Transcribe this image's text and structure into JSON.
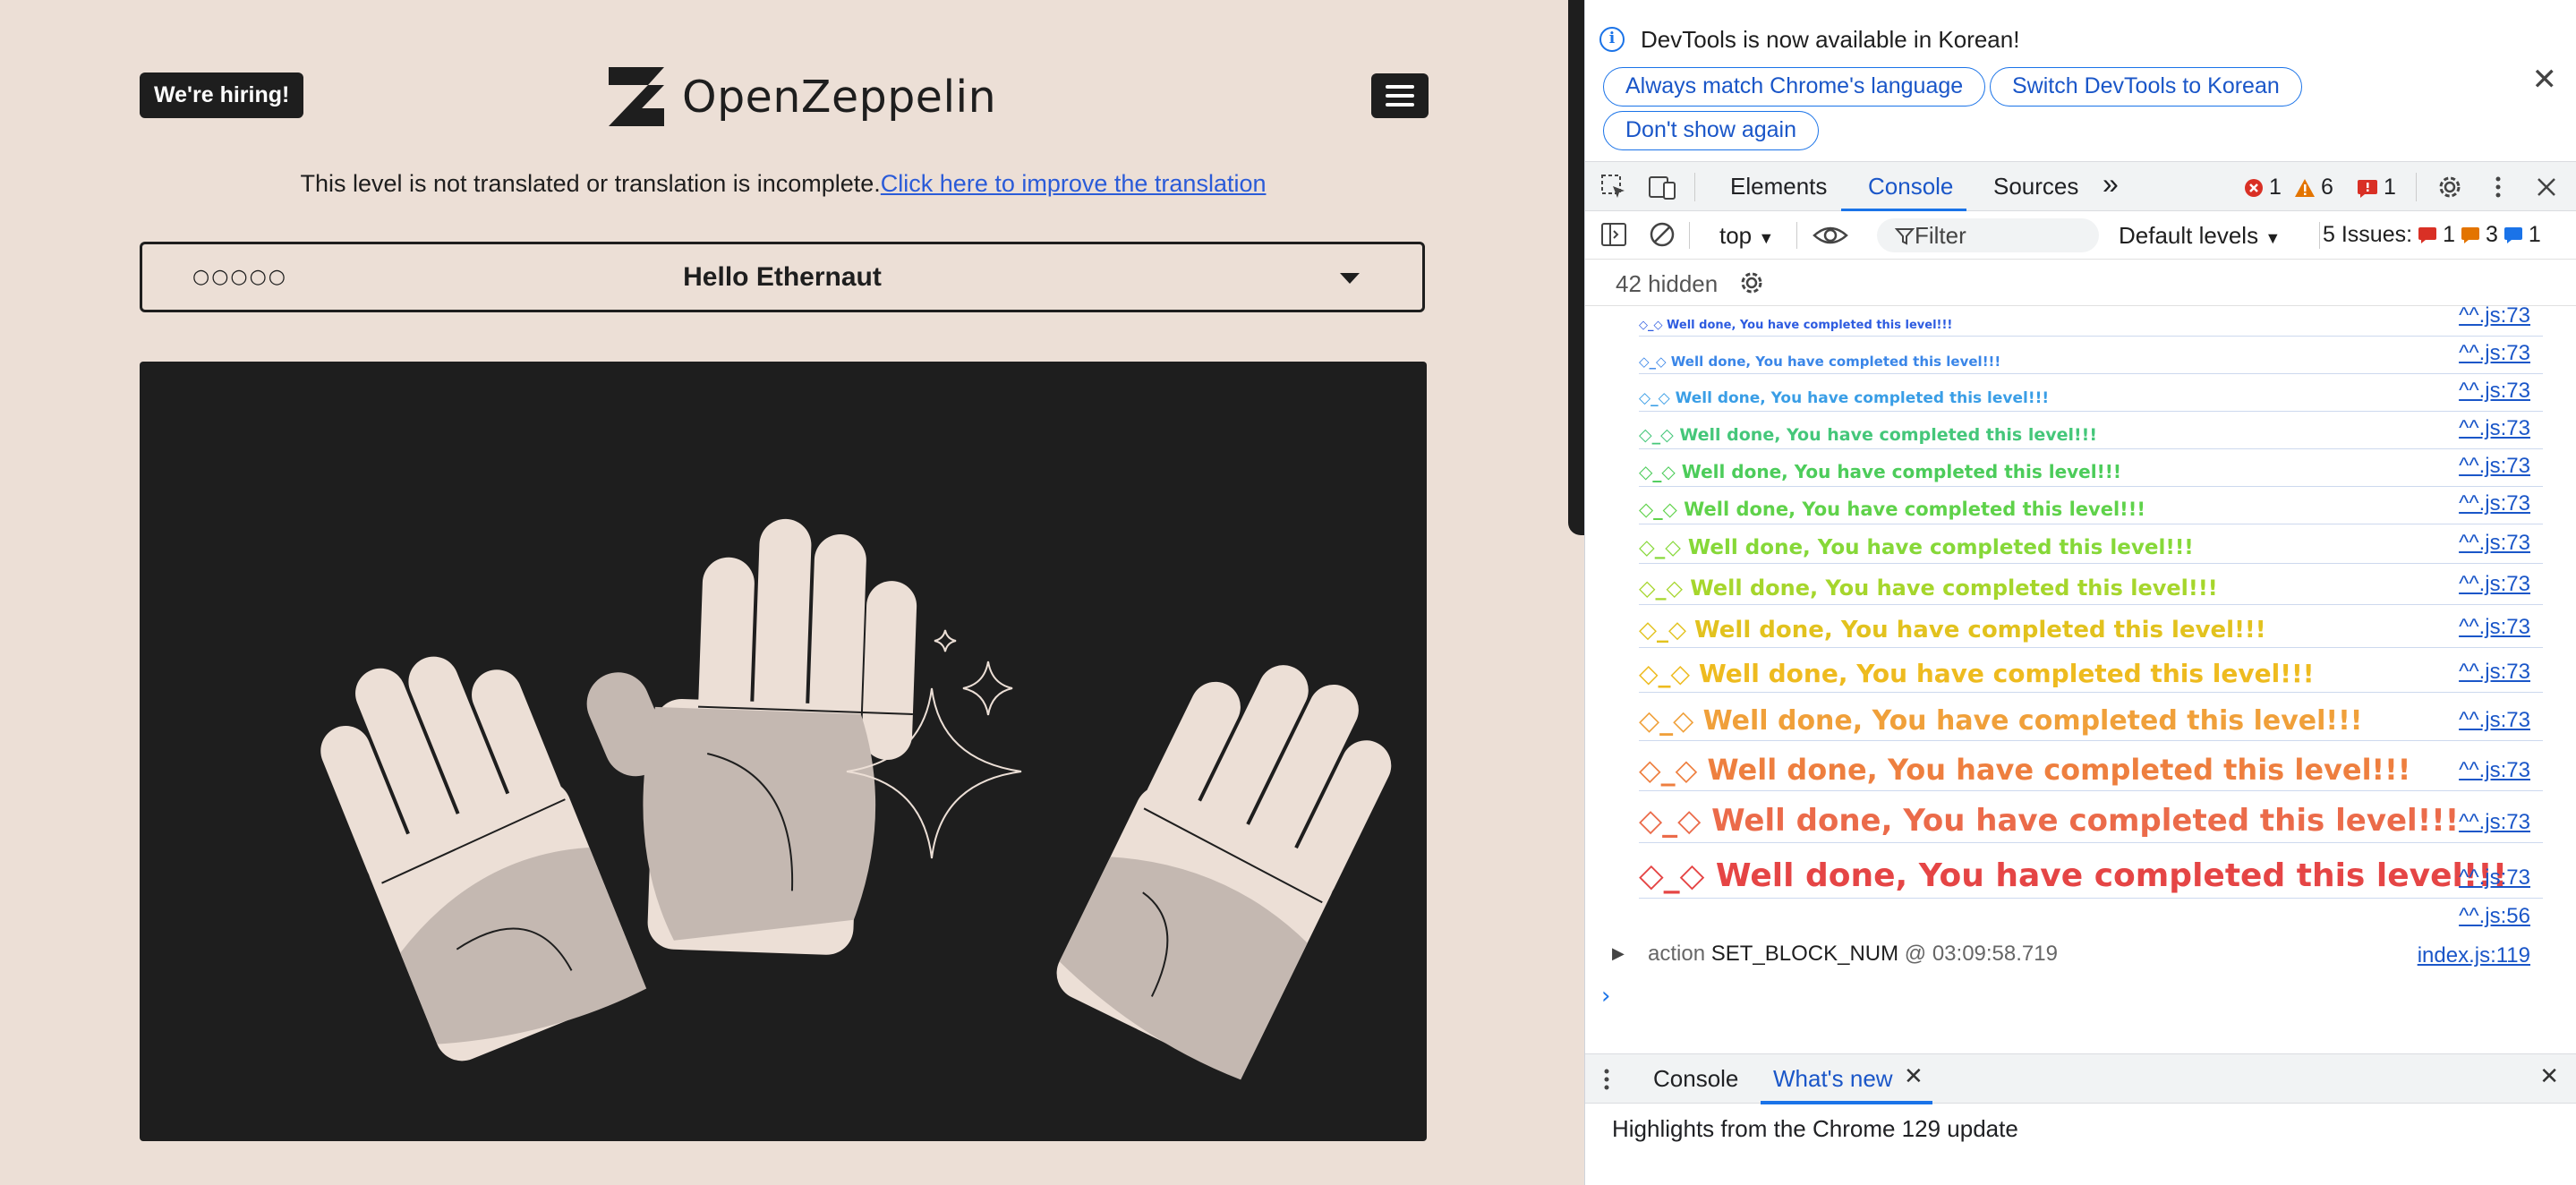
{
  "page": {
    "hiring_label": "We're hiring!",
    "brand_name": "OpenZeppelin",
    "translation_notice": "This level is not translated or translation is incomplete.",
    "translation_link": "Click here to improve the translation",
    "level_difficulty_dots": "○○○○○",
    "level_title": "Hello Ethernaut"
  },
  "devtools": {
    "infobar": {
      "message": "DevTools is now available in Korean!",
      "buttons": [
        "Always match Chrome's language",
        "Switch DevTools to Korean",
        "Don't show again"
      ]
    },
    "tabs": {
      "elements": "Elements",
      "console": "Console",
      "sources": "Sources",
      "more": "»"
    },
    "counts": {
      "errors": "1",
      "warnings": "6",
      "issues_flag": "1"
    },
    "toolbar": {
      "context": "top",
      "filter_placeholder": "Filter",
      "levels": "Default levels",
      "issues_label": "5 Issues:",
      "issues_counts": [
        "1",
        "3",
        "1"
      ],
      "hidden": "42 hidden"
    },
    "log_message": "◇_◇ Well done, You have completed this level!!!",
    "log_source": "^^.js:73",
    "last_source": "^^.js:56",
    "log_colors": [
      "#2d5be0",
      "#3a86e8",
      "#3a9ee6",
      "#45c77a",
      "#4ccc5a",
      "#5fd24a",
      "#86d838",
      "#a6d62c",
      "#e2c21e",
      "#eebb1f",
      "#f0a03a",
      "#ee7f3f",
      "#eb6b4a",
      "#e54545"
    ],
    "action": {
      "prefix": "action",
      "name": "SET_BLOCK_NUM",
      "at": "@",
      "time": "03:09:58.719",
      "source": "index.js:119"
    },
    "prompt": "›",
    "drawer": {
      "tab_console": "Console",
      "tab_whats_new": "What's new",
      "content": "Highlights from the Chrome 129 update"
    }
  }
}
